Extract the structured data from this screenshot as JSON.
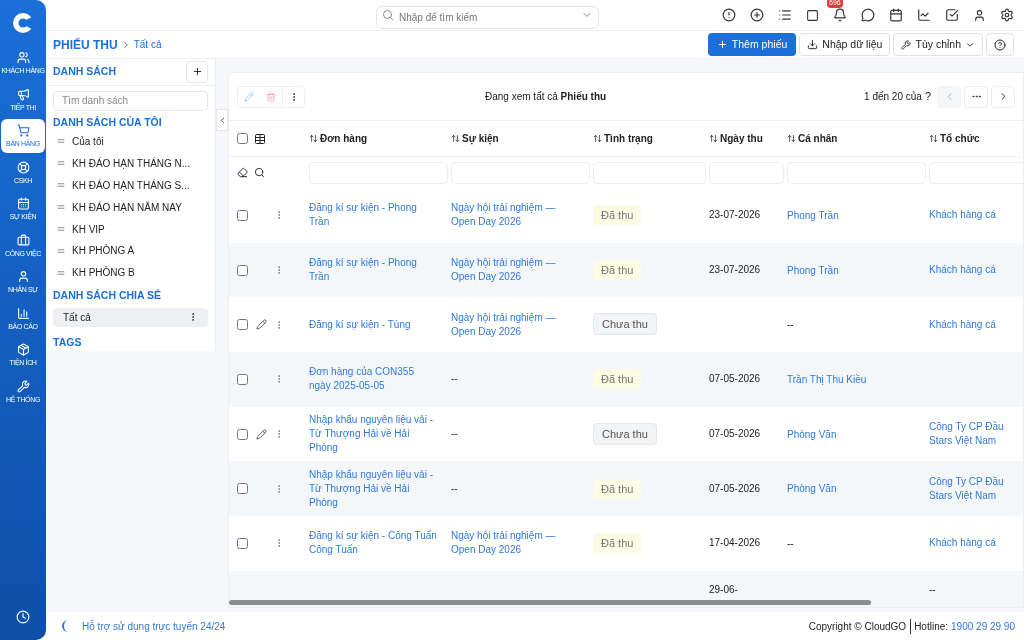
{
  "nav": [
    {
      "label": "KHÁCH HÀNG",
      "kind": "users",
      "selected": false
    },
    {
      "label": "TIẾP THỊ",
      "kind": "megaphone",
      "selected": false
    },
    {
      "label": "BÁN HÀNG",
      "kind": "cart",
      "selected": true
    },
    {
      "label": "CSKH",
      "kind": "lifebuoy",
      "selected": false
    },
    {
      "label": "SỰ KIỆN",
      "kind": "calendar",
      "selected": false
    },
    {
      "label": "CÔNG VIỆC",
      "kind": "briefcase",
      "selected": false
    },
    {
      "label": "NHÂN SỰ",
      "kind": "user",
      "selected": false
    },
    {
      "label": "BÁO CÁO",
      "kind": "report",
      "selected": false
    },
    {
      "label": "TIỆN ÍCH",
      "kind": "package",
      "selected": false
    },
    {
      "label": "HỆ THỐNG",
      "kind": "wrench",
      "selected": false
    }
  ],
  "search": {
    "placeholder": "Nhập để tìm kiếm"
  },
  "notifications": {
    "count": "696"
  },
  "breadcrumb": {
    "module": "PHIẾU THU",
    "current": "Tất cả"
  },
  "actions": {
    "add": "Thêm phiếu",
    "import": "Nhập dữ liệu",
    "customize": "Tùy chỉnh"
  },
  "lists_panel": {
    "title": "DANH SÁCH",
    "search_placeholder": "Tìm danh sách",
    "my_title": "DANH SÁCH CỦA TÔI",
    "my_lists": [
      "Của tôi",
      "KH ĐÁO HẠN THÁNG N...",
      "KH ĐÁO HẠN THÁNG S...",
      "KH ĐÁO HẠN NĂM NAY",
      "KH VIP",
      "KH PHÒNG A",
      "KH PHÒNG B"
    ],
    "shared_title": "DANH SÁCH CHIA SẺ",
    "shared_lists": [
      {
        "label": "Tất cả",
        "selected": true
      }
    ],
    "tags_title": "TAGS"
  },
  "toolbar": {
    "viewing": "Đang xem tất cả **Phiếu thu**",
    "range": "1 đến 20 của",
    "unknown_total": "?"
  },
  "table": {
    "select_all_checked": false,
    "columns": [
      "Đơn hàng",
      "Sự kiện",
      "Tình trạng",
      "Ngày thu",
      "Cá nhân",
      "Tổ chức"
    ],
    "rows": [
      {
        "checked": false,
        "editable": false,
        "order": "Đăng kí sự kiện - Phong Trần",
        "event": "Ngày hội trải nghiệm — Open Day 2026",
        "status": {
          "text": "Đã thu",
          "kind": "paid"
        },
        "date": "23-07-2026",
        "person": "Phong Trần",
        "org": "Khách hàng cá"
      },
      {
        "checked": false,
        "editable": false,
        "order": "Đăng kí sự kiện - Phong Trần",
        "event": "Ngày hội trải nghiệm — Open Day 2026",
        "status": {
          "text": "Đã thu",
          "kind": "paid"
        },
        "date": "23-07-2026",
        "person": "Phong Trần",
        "org": "Khách hàng cá"
      },
      {
        "checked": false,
        "editable": true,
        "order": "Đăng kí sự kiện - Tùng",
        "event": "Ngày hội trải nghiệm — Open Day 2026",
        "status": {
          "text": "Chưa thu",
          "kind": "unpaid"
        },
        "person": "--",
        "org": "Khách hàng cá"
      },
      {
        "checked": false,
        "editable": false,
        "order": "Đơn hàng của CON355 ngày 2025-05-05",
        "event": "--",
        "status": {
          "text": "Đã thu",
          "kind": "paid"
        },
        "date": "07-05-2026",
        "person": "Trần Thị Thu Kiều"
      },
      {
        "checked": false,
        "editable": true,
        "order": "Nhập khẩu nguyên liệu vải - Từ Thượng Hải về Hải Phòng",
        "event": "--",
        "status": {
          "text": "Chưa thu",
          "kind": "unpaid"
        },
        "date": "07-05-2026",
        "person": "Phòng Văn",
        "org": "Công Ty CP Đầu\nStars Việt Nam"
      },
      {
        "checked": false,
        "editable": false,
        "order": "Nhập khẩu nguyên liệu vải - Từ Thượng Hải về Hải Phòng",
        "event": "--",
        "status": {
          "text": "Đã thu",
          "kind": "paid"
        },
        "date": "07-05-2026",
        "person": "Phòng Văn",
        "org": "Công Ty CP Đầu\nStars Việt Nam"
      },
      {
        "checked": false,
        "editable": false,
        "order": "Đăng kí sự kiện - Công Tuấn Công Tuấn",
        "event": "Ngày hội trải nghiệm — Open Day 2026",
        "status": {
          "text": "Đã thu",
          "kind": "paid"
        },
        "date": "17-04-2026",
        "person": "--",
        "org": "Khách hàng cá"
      },
      {
        "editable": false,
        "date": "29-06-",
        "org": "--"
      }
    ]
  },
  "footer": {
    "support": "Hỗ trợ sử dụng trực tuyến 24/24",
    "copyright": "Copyright © CloudGO",
    "hotline_label": "Hotline:",
    "hotline": "1900 29 29 90"
  }
}
